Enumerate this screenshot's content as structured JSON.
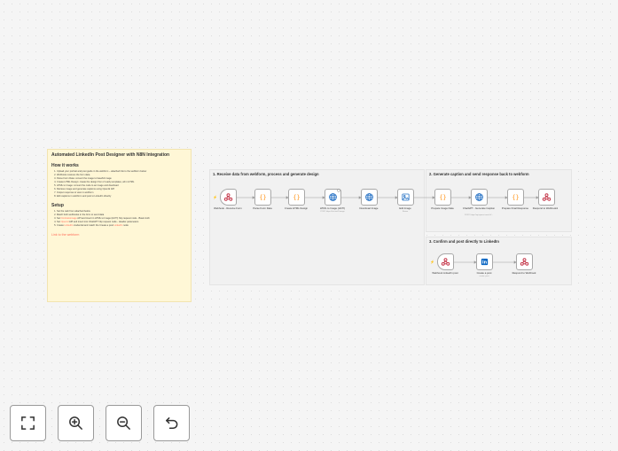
{
  "note": {
    "title": "Automated LinkedIn Post Designer with N8N Integration",
    "how_heading": "How it works",
    "how_steps": [
      "Upload your portrait and post guide in the webform – attached link to the webform below",
      "Webhook receives the form data",
      "Parse Form Data: convert the image to base64 image",
      "Create HTML Design: create the design from 2 ready templates, all in HTML",
      "HTML to Image: convert the code to an image and download",
      "Retrieve image and generate captions using OpenAI API",
      "Output response to view in webform",
      "Edit captions in webform and post to LinkedIn directly"
    ],
    "setup_heading": "Setup",
    "setup_steps": [
      "Set the web from attached below",
      "Match both webhooks in the form to send data",
      "Set htmlcsstoimage API and insert in HTML to Image (HCTI) http request node - Basic Auth",
      "Set OpenAI API and insert into ChatGPT http request node - Header parameters",
      "Create LinkedIn credential and match the Create a post LinkedIn node"
    ],
    "setup_highlights": [
      "htmlcsstoimage",
      "OpenAI",
      "LinkedIn"
    ],
    "link": "Link to the webform"
  },
  "sections": [
    {
      "title": "1. Receive data from webform, process and generate design"
    },
    {
      "title": "2. Generate caption and send response back to webform"
    },
    {
      "title": "3. Confirm and post directly to LinkedIn"
    }
  ],
  "nodes": [
    {
      "id": "n1",
      "label": "Webhook - Receive Form",
      "sub": "",
      "icon": "webhook-icon",
      "trigger": true
    },
    {
      "id": "n2",
      "label": "Parse Form Data",
      "sub": "",
      "icon": "code-icon"
    },
    {
      "id": "n3",
      "label": "Create HTML Design",
      "sub": "",
      "icon": "code-icon"
    },
    {
      "id": "n4",
      "label": "HTML to Image (HCTI)",
      "sub": "POST: https://hcti.io/v1/image",
      "icon": "globe-icon"
    },
    {
      "id": "n5",
      "label": "Download Image",
      "sub": "",
      "icon": "globe-icon"
    },
    {
      "id": "n6",
      "label": "Edit Image",
      "sub": "Resize",
      "icon": "image-icon"
    },
    {
      "id": "n7",
      "label": "Prepare Image Data",
      "sub": "",
      "icon": "code-icon"
    },
    {
      "id": "n8",
      "label": "ChatGPT - Generate Caption",
      "sub": "POST: https://api.openai.com/v1/...",
      "icon": "globe-icon"
    },
    {
      "id": "n9",
      "label": "Prepare Final Response",
      "sub": "",
      "icon": "code-icon"
    },
    {
      "id": "n10",
      "label": "Respond to Webhook1",
      "sub": "",
      "icon": "webhook-icon"
    },
    {
      "id": "n11",
      "label": "Webhook LinkedIn post",
      "sub": "",
      "icon": "webhook-icon",
      "trigger": true
    },
    {
      "id": "n12",
      "label": "Create a post",
      "sub": "create: post",
      "icon": "linkedin-icon"
    },
    {
      "id": "n13",
      "label": "Respond to Webhook",
      "sub": "",
      "icon": "webhook-icon"
    }
  ],
  "colors": {
    "canvas": "#f5f5f5",
    "sticky_note": "#fff7d6",
    "accent": "#ff6d5a",
    "code_node": "#ff9922",
    "http_node": "#2672c5",
    "webhook_node": "#c5384b",
    "linkedin_node": "#0a66c2",
    "edge": "#9b9b9b"
  },
  "controls": [
    {
      "name": "zoom-to-fit-button",
      "icon": "fit-view-icon"
    },
    {
      "name": "zoom-in-button",
      "icon": "zoom-in-icon"
    },
    {
      "name": "zoom-out-button",
      "icon": "zoom-out-icon"
    },
    {
      "name": "reset-zoom-button",
      "icon": "undo-icon"
    }
  ]
}
